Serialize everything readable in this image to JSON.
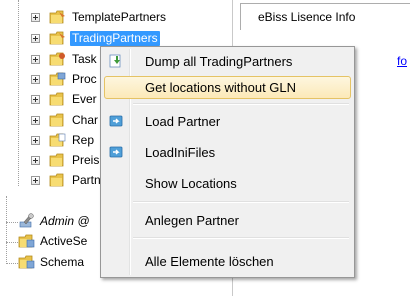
{
  "tree": {
    "items": [
      {
        "label": "TemplatePartners",
        "name": "tree-item-templatepartners"
      },
      {
        "label": "TradingPartners",
        "name": "tree-item-tradingpartners",
        "selected": true
      },
      {
        "label": "Task",
        "name": "tree-item-tasks"
      },
      {
        "label": "Proc",
        "name": "tree-item-proc"
      },
      {
        "label": "Ever",
        "name": "tree-item-events"
      },
      {
        "label": "Char",
        "name": "tree-item-char"
      },
      {
        "label": "Rep",
        "name": "tree-item-rep"
      },
      {
        "label": "Preis",
        "name": "tree-item-preis"
      },
      {
        "label": "Partn",
        "name": "tree-item-partn"
      },
      {
        "label": "Admin @",
        "name": "tree-item-admin"
      },
      {
        "label": "ActiveSe",
        "name": "tree-item-activese"
      },
      {
        "label": "Schema",
        "name": "tree-item-schema"
      }
    ]
  },
  "panel": {
    "tab_title": "eBiss Lisence Info",
    "link_fragment": "fo"
  },
  "context_menu": {
    "items": [
      {
        "label": "Dump all TradingPartners",
        "icon": "dump-icon"
      },
      {
        "label": "Get locations without GLN",
        "highlighted": true
      },
      {
        "label": "Load Partner",
        "icon": "load-icon"
      },
      {
        "label": "LoadIniFiles",
        "icon": "load-icon"
      },
      {
        "label": "Show Locations"
      },
      {
        "label": "Anlegen Partner"
      },
      {
        "label": "Alle Elemente löschen"
      }
    ]
  },
  "colors": {
    "selection": "#3399ff",
    "menu_highlight_border": "#e5c365",
    "link": "#0000ff"
  }
}
